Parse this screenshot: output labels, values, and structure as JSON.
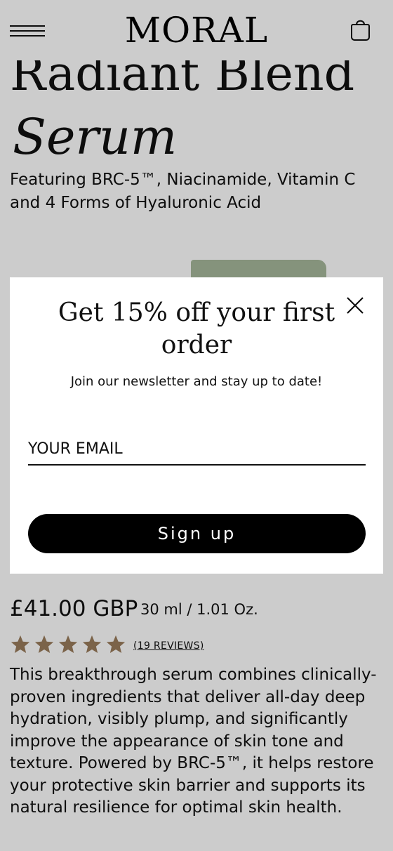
{
  "header": {
    "logo": "MORAL",
    "menu_icon": "hamburger-menu-icon",
    "bag_icon": "shopping-bag-icon"
  },
  "product": {
    "title_line1": "Radiant Blend",
    "title_line2": "Serum",
    "subtitle": "Featuring BRC-5™, Niacinamide, Vitamin C and 4 Forms of Hyaluronic Acid",
    "price": "£41.00 GBP",
    "size": "30 ml / 1.01 Oz.",
    "rating": 5,
    "rating_max": 5,
    "reviews_label": "(19 REVIEWS)",
    "description": "This breakthrough serum combines clinically-proven ingredients that deliver all-day deep hydration, visibly plump, and significantly improve the appearance of skin tone and texture. Powered by BRC-5™, it helps restore your protective skin barrier and supports its natural resilience for optimal skin health."
  },
  "modal": {
    "title": "Get 15% off your first order",
    "subtitle": "Join our newsletter and stay up to date!",
    "email_placeholder": "YOUR EMAIL",
    "email_value": "",
    "signup_label": "Sign up",
    "close_icon": "close-icon"
  },
  "colors": {
    "star": "#9a7c5c",
    "button_bg": "#000000",
    "overlay": "rgba(0,0,0,0.2)",
    "product_box": "#a7b89c"
  }
}
